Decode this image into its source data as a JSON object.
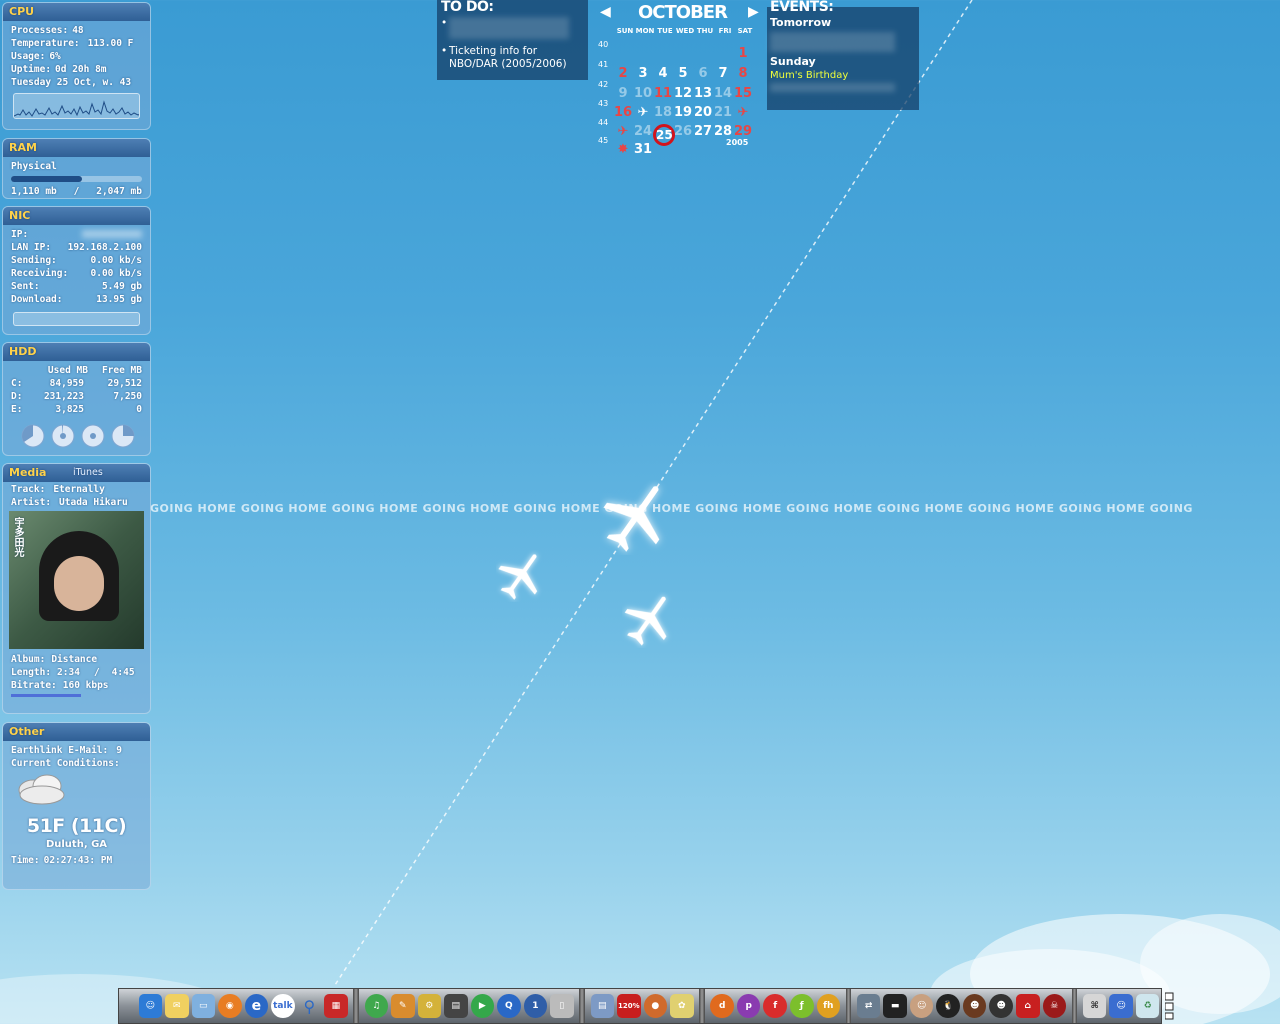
{
  "cpu": {
    "title": "CPU",
    "rows": [
      {
        "k": "Processes:",
        "v": "48"
      },
      {
        "k": "Temperature:",
        "v": "113.00 F"
      },
      {
        "k": "Usage:",
        "v": "6%"
      },
      {
        "k": "Uptime:",
        "v": "0d 20h 8m"
      },
      {
        "k": "Tuesday 25 Oct, w. 43",
        "v": ""
      }
    ]
  },
  "ram": {
    "title": "RAM",
    "label": "Physical",
    "used": "1,110 mb",
    "sep": "/",
    "total": "2,047 mb",
    "usage_fraction": 0.54
  },
  "nic": {
    "title": "NIC",
    "rows": [
      {
        "k": "IP:",
        "v": "",
        "blur": true
      },
      {
        "k": "LAN IP:",
        "v": "192.168.2.100"
      },
      {
        "k": "Sending:",
        "v": "0.00 kb/s"
      },
      {
        "k": "Receiving:",
        "v": "0.00 kb/s"
      },
      {
        "k": "Sent:",
        "v": "5.49 gb"
      },
      {
        "k": "Download:",
        "v": "13.95 gb"
      }
    ]
  },
  "hdd": {
    "title": "HDD",
    "col_used": "Used MB",
    "col_free": "Free MB",
    "drives": [
      {
        "name": "C:",
        "used": "84,959",
        "free": "29,512"
      },
      {
        "name": "D:",
        "used": "231,223",
        "free": "7,250"
      },
      {
        "name": "E:",
        "used": "3,825",
        "free": "0"
      }
    ]
  },
  "media": {
    "title": "Media",
    "player": "iTunes",
    "track_label": "Track:",
    "track": "Eternally",
    "artist_label": "Artist:",
    "artist": "Utada Hikaru",
    "album_label": "Album:",
    "album": "Distance",
    "length_label": "Length:",
    "position": "2:34",
    "length_sep": "/",
    "length": "4:45",
    "bitrate_label": "Bitrate:",
    "bitrate": "160 kbps",
    "cover_text": "宇多田光"
  },
  "other": {
    "title": "Other",
    "email_label": "Earthlink E-Mail:",
    "email_count": "9",
    "conditions_label": "Current Conditions:",
    "temperature": "51F (11C)",
    "location": "Duluth, GA",
    "time_label": "Time:",
    "time": "02:27:43: PM"
  },
  "todo": {
    "title": "TO DO:",
    "items": [
      {
        "text": "",
        "blur": true
      },
      {
        "text": "Ticketing info for NBO/DAR (2005/2006)"
      }
    ]
  },
  "calendar": {
    "month": "OCTOBER",
    "year": "2005",
    "dow": [
      "SUN",
      "MON",
      "TUE",
      "WED",
      "THU",
      "FRI",
      "SAT"
    ],
    "weeks": [
      "40",
      "41",
      "42",
      "43",
      "44",
      "45"
    ],
    "today": "25"
  },
  "events": {
    "title": "EVENTS:",
    "day1": "Tomorrow",
    "day2": "Sunday",
    "birthday": "Mum's Birthday"
  },
  "banner": "GOING HOME GOING HOME GOING HOME GOING HOME GOING HOME GOING HOME GOING HOME GOING HOME GOING HOME GOING HOME GOING HOME GOING",
  "dock": {
    "itunes_badge": "120%"
  }
}
